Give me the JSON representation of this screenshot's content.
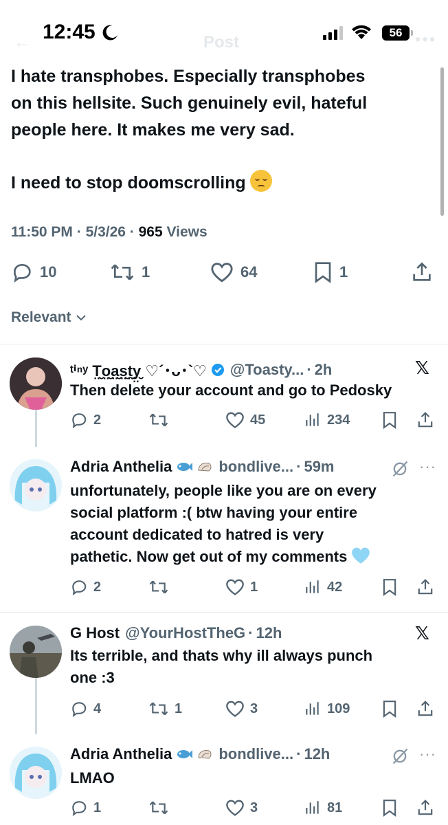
{
  "status_bar": {
    "time": "12:45",
    "battery": "56"
  },
  "nav": {
    "title_ghost": "Post"
  },
  "main_tweet": {
    "line1": "I hate transphobes. Especially transphobes",
    "line2": "on this hellsite. Such genuinely evil, hateful",
    "line3": "people here. It makes me very sad.",
    "line4": "I need to stop doomscrolling",
    "time": "11:50 PM",
    "date": "5/3/26",
    "views_count": "965",
    "views_label": "Views",
    "replies": "10",
    "reposts": "1",
    "likes": "64",
    "bookmarks": "1"
  },
  "sort": {
    "label": "Relevant"
  },
  "replies": [
    {
      "name": "ᵗⁱⁿʸ T̤̮o̤̮a̤̮s̤̮t̤̮y̤̮ ♡´･ᴗ･`♡",
      "handle": "@Toasty...",
      "time": "2h",
      "body": "Then delete your account and go to Pedosky",
      "replies": "2",
      "reposts": "",
      "likes": "45",
      "views": "234"
    },
    {
      "name": "Adria Anthelia",
      "handle": "bondlive...",
      "time": "59m",
      "body_l1": "unfortunately, people like you are on every",
      "body_l2": "social platform :( btw having your entire",
      "body_l3": "account dedicated to hatred is very",
      "body_l4": "pathetic. Now get out of my comments",
      "replies": "2",
      "reposts": "",
      "likes": "1",
      "views": "42"
    },
    {
      "name": "G Host",
      "handle": "@YourHostTheG",
      "time": "12h",
      "body_l1": "Its terrible, and thats why ill always punch",
      "body_l2": "one :3",
      "replies": "4",
      "reposts": "1",
      "likes": "3",
      "views": "109"
    },
    {
      "name": "Adria Anthelia",
      "handle": "bondlive...",
      "time": "12h",
      "body": "LMAO",
      "replies": "1",
      "reposts": "",
      "likes": "3",
      "views": "81"
    }
  ],
  "colors": {
    "text": "#0f1419",
    "muted": "#536471",
    "divider": "#e1e8ed",
    "verified": "#1d9bf0"
  }
}
